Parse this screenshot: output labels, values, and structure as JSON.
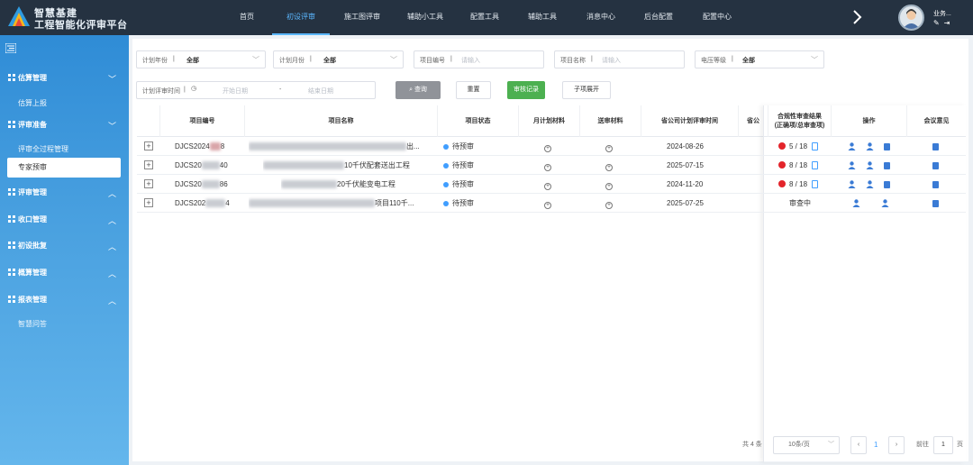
{
  "brand": {
    "line1": "智慧基建",
    "line2": "工程智能化评审平台"
  },
  "nav": {
    "items": [
      "首页",
      "初设评审",
      "施工图评审",
      "辅助小工具",
      "配置工具",
      "辅助工具",
      "消息中心",
      "后台配置",
      "配置中心"
    ],
    "active_index": 1
  },
  "user": {
    "name": "业务..."
  },
  "sidebar": {
    "groups": [
      {
        "label": "估算管理",
        "expanded": true,
        "sub": [
          "估算上报"
        ]
      },
      {
        "label": "评审准备",
        "expanded": true,
        "sub": [
          "评审全过程管理",
          "专家预审"
        ]
      },
      {
        "label": "评审管理",
        "expanded": false
      },
      {
        "label": "收口管理",
        "expanded": false
      },
      {
        "label": "初设批复",
        "expanded": false
      },
      {
        "label": "概算管理",
        "expanded": false
      },
      {
        "label": "报表管理",
        "expanded": true,
        "sub": [
          "智慧问答"
        ]
      }
    ],
    "active_item": "专家预审"
  },
  "filters": {
    "plan_year": {
      "label": "计划年份",
      "value": "全部"
    },
    "plan_month": {
      "label": "计划月份",
      "value": "全部"
    },
    "project_code": {
      "label": "项目编号",
      "placeholder": "请输入"
    },
    "project_name": {
      "label": "项目名称",
      "placeholder": "请输入"
    },
    "voltage": {
      "label": "电压等级",
      "value": "全部"
    },
    "review_time": {
      "label": "计划评审时间",
      "start_placeholder": "开始日期",
      "separator": "-",
      "end_placeholder": "结束日期"
    }
  },
  "buttons": {
    "query": "查询",
    "reset": "重置",
    "audit_records": "审核记录",
    "expand_children": "子项展开"
  },
  "table": {
    "headers": {
      "code": "项目编号",
      "name": "项目名称",
      "status": "项目状态",
      "monthly": "月计划材料",
      "submitted": "送审材料",
      "provincial": "省公司计划评审时间",
      "prov_short": "省公",
      "compliance": "合规性审查结果",
      "compliance_sub": "(正确项/总审查项)",
      "ops": "操作",
      "opinion": "会议意见"
    },
    "rows": [
      {
        "code": "DJCS2024",
        "code_tail": "8",
        "name_tail": "出...",
        "status": "待预审",
        "time": "2024-08-26",
        "result": "5 / 18"
      },
      {
        "code": "DJCS20",
        "code_tail": "40",
        "name_tail": "10千伏配套送出工程",
        "status": "待预审",
        "time": "2025-07-15",
        "result": "8 / 18"
      },
      {
        "code": "DJCS20",
        "code_tail": "86",
        "name_tail": "20千伏能变电工程",
        "status": "待预审",
        "time": "2024-11-20",
        "result": "8 / 18"
      },
      {
        "code": "DJCS202",
        "code_tail": "4",
        "name_tail": "项目110千...",
        "status": "待预审",
        "time": "2025-07-25",
        "result": "审查中"
      }
    ]
  },
  "pagination": {
    "total": "共 4 条",
    "page_size": "10条/页",
    "current": "1",
    "goto_label": "前往",
    "goto_value": "1",
    "page_unit": "页"
  }
}
